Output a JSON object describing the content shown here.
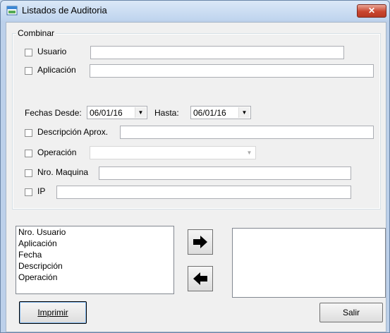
{
  "window": {
    "title": "Listados de Auditoria",
    "close_glyph": "✕"
  },
  "combinar": {
    "legend": "Combinar",
    "usuario": {
      "label": "Usuario",
      "value": ""
    },
    "aplicacion": {
      "label": "Aplicación",
      "value": ""
    },
    "fechas_desde_label": "Fechas Desde:",
    "fechas_desde_value": "06/01/16",
    "hasta_label": "Hasta:",
    "hasta_value": "06/01/16",
    "descripcion": {
      "label": "Descripción Aprox.",
      "value": ""
    },
    "operacion": {
      "label": "Operación",
      "value": ""
    },
    "nro_maquina": {
      "label": "Nro. Maquina",
      "value": ""
    },
    "ip": {
      "label": "IP",
      "value": ""
    }
  },
  "columns": {
    "available": [
      "Nro. Usuario",
      "Aplicación",
      "Fecha",
      "Descripción",
      "Operación"
    ],
    "selected": []
  },
  "buttons": {
    "imprimir": "Imprimir",
    "salir": "Salir"
  },
  "icons": {
    "move_right": "arrow-right-icon",
    "move_left": "arrow-left-icon",
    "app": "window-icon"
  }
}
